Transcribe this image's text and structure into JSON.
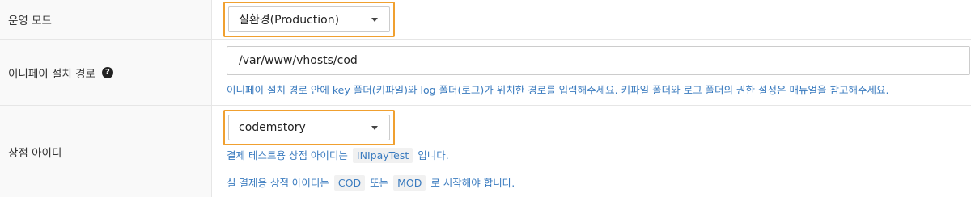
{
  "rows": {
    "mode": {
      "label": "운영 모드",
      "select_value": "실환경(Production)"
    },
    "install_path": {
      "label": "이니페이 설치 경로",
      "input_value": "/var/www/vhosts/cod",
      "help": "이니페이 설치 경로 안에 key 폴더(키파일)와 log 폴더(로그)가 위치한 경로를 입력해주세요. 키파일 폴더와 로그 폴더의 권한 설정은 매뉴얼을 참고해주세요."
    },
    "store_id": {
      "label": "상점 아이디",
      "select_value": "codemstory",
      "help1_prefix": "결제 테스트용 상점 아이디는",
      "help1_code": "INIpayTest",
      "help1_suffix": "입니다.",
      "help2_prefix": "실 결제용 상점 아이디는",
      "help2_code1": "COD",
      "help2_mid": "또는",
      "help2_code2": "MOD",
      "help2_suffix": "로 시작해야 합니다."
    }
  },
  "icons": {
    "help": "question-circle-icon"
  },
  "colors": {
    "highlight": "#f0a030",
    "help_text": "#3a7bbf"
  }
}
